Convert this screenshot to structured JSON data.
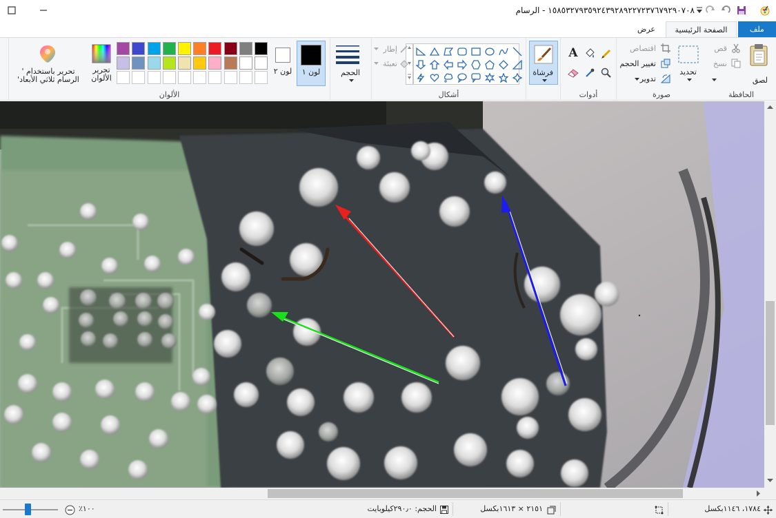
{
  "window": {
    "title": "١٥٨٥٣٢٧٩٣٥٩٢٤٣٩٢٨٩٢٢٧٢٣٧٦٧٩٢٩٠٧٠٨ - الرسام"
  },
  "tabs": {
    "file": "ملف",
    "home": "الصفحة الرئيسية",
    "view": "عرض"
  },
  "clipboard": {
    "label": "الحافظة",
    "paste": "لصق",
    "cut": "قص",
    "copy": "نسخ"
  },
  "image": {
    "label": "صورة",
    "select": "تحديد",
    "crop": "اقتصاص",
    "resize": "تغيير الحجم",
    "rotate": "تدوير"
  },
  "tools": {
    "label": "أدوات",
    "brushes": "فرشاة"
  },
  "shapes": {
    "label": "أشكال",
    "outline": "إطار",
    "fill": "تعبئة"
  },
  "size": {
    "label": "الحجم"
  },
  "colors": {
    "label": "الألوان",
    "color1": "لون ١",
    "color2": "لون ٢",
    "edit_colors": "تحرير الألوان",
    "paint3d": "تحرير باستخدام ' الرسام ثلاثي الأبعاد'",
    "color1_value": "#000000",
    "color2_value": "#ffffff",
    "palette_row1": [
      "#000000",
      "#7f7f7f",
      "#880015",
      "#ed1c24",
      "#ff7f27",
      "#fff200",
      "#22b14c",
      "#00a2e8",
      "#3f48cc",
      "#a349a4"
    ],
    "palette_row2": [
      "#ffffff",
      "#ffffff",
      "#b97a57",
      "#ffaec9",
      "#ffc90e",
      "#efe4b0",
      "#b5e61d",
      "#99d9ea",
      "#7092be",
      "#c8bfe7"
    ]
  },
  "status": {
    "cursor": "١٧٨٤، ١١٤٦بكسل",
    "dimensions": "٢١٥١ × ١٦١٣بكسل",
    "filesize": "الحجم: ٢٩٠٫٠كيلوبايت",
    "zoom": "١٠٠٪"
  }
}
